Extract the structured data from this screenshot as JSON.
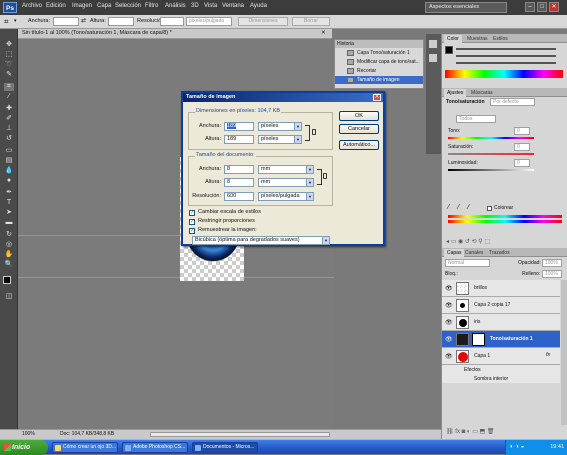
{
  "menu": {
    "logo": "Ps",
    "items": [
      "Archivo",
      "Edición",
      "Imagen",
      "Capa",
      "Selección",
      "Filtro",
      "Análisis",
      "3D",
      "Vista",
      "Ventana",
      "Ayuda"
    ],
    "workspace": "Aspectos esenciales",
    "window_controls": [
      "–",
      "□",
      "✕"
    ]
  },
  "options_bar": {
    "width_label": "Anchura:",
    "height_label": "Altura:",
    "resolution_label": "Resolución:",
    "resolution_unit": "píxeles/pulgada",
    "front_image_button": "Dimensiones",
    "clear_button": "Borrar"
  },
  "document": {
    "tab_title": "Sin título-1 al 100% (Tono/saturación 1, Máscara de capa/8) *"
  },
  "history": {
    "header": "Historia",
    "items": [
      {
        "label": "Capa Tono/saturación 1",
        "selected": false
      },
      {
        "label": "Modificar capa de tono/sat...",
        "selected": false
      },
      {
        "label": "Recortar",
        "selected": false
      },
      {
        "label": "Tamaño de imagen",
        "selected": true
      }
    ]
  },
  "dialog": {
    "title": "Tamaño de imagen",
    "close_glyph": "X",
    "pixel_dimensions_label": "Dimensiones en píxeles: 104,7 KB",
    "px_width_label": "Anchura:",
    "px_width_value": "189",
    "px_width_unit": "píxeles",
    "px_height_label": "Altura:",
    "px_height_value": "189",
    "px_height_unit": "píxeles",
    "doc_size_label": "Tamaño del documento:",
    "doc_width_label": "Anchura:",
    "doc_width_value": "8",
    "doc_width_unit": "mm",
    "doc_height_label": "Altura:",
    "doc_height_value": "8",
    "doc_height_unit": "mm",
    "resolution_label": "Resolución:",
    "resolution_value": "600",
    "resolution_unit": "píxeles/pulgada",
    "scale_styles_label": "Cambiar escala de estilos",
    "constrain_label": "Restringir proporciones",
    "resample_label": "Remuestrear la imagen:",
    "resample_method": "Bicúbica (óptima para degradados suaves)",
    "ok_button": "OK",
    "cancel_button": "Cancelar",
    "auto_button": "Automático..."
  },
  "color_panel": {
    "tabs": [
      "Color",
      "Muestras",
      "Estilos"
    ]
  },
  "adjustments_panel": {
    "tabs": [
      "Ajustes",
      "Máscaras"
    ],
    "title": "Tono/saturación",
    "preset": "Por defecto",
    "edit": "Todos",
    "hue_label": "Tono:",
    "hue_value": "0",
    "saturation_label": "Saturación:",
    "saturation_value": "0",
    "lightness_label": "Luminosidad:",
    "lightness_value": "0",
    "colorize_label": "Colorear"
  },
  "layers_panel": {
    "tabs": [
      "Capas",
      "Canales",
      "Trazados"
    ],
    "blend_mode": "Normal",
    "opacity_label": "Opacidad:",
    "opacity_value": "100%",
    "lock_label": "Bloq.:",
    "fill_label": "Relleno:",
    "fill_value": "100%",
    "layers": [
      {
        "name": "brillos",
        "selected": false
      },
      {
        "name": "Capa 2 copia 17",
        "selected": false
      },
      {
        "name": "iris",
        "selected": false
      },
      {
        "name": "Tono/saturación 1",
        "selected": true
      },
      {
        "name": "Capa 1",
        "selected": false
      }
    ],
    "effects_label": "Efectos",
    "inner_shadow_label": "Sombra interior"
  },
  "status_bar": {
    "zoom": "100%",
    "doc_info": "Doc: 104,7 KB/348,8 KB"
  },
  "taskbar": {
    "start": "Inicio",
    "tasks": [
      {
        "label": "Cómo crear un ojo 3D...",
        "active": false
      },
      {
        "label": "Adobe Photoshop CS...",
        "active": false
      },
      {
        "label": "Documentos - Micros...",
        "active": true
      }
    ],
    "clock": "19:41"
  },
  "colors": {
    "dialog_title": "#0a246a",
    "selection": "#3a6cc8",
    "taskbar": "#2458c8",
    "start": "#3a9a2e"
  }
}
